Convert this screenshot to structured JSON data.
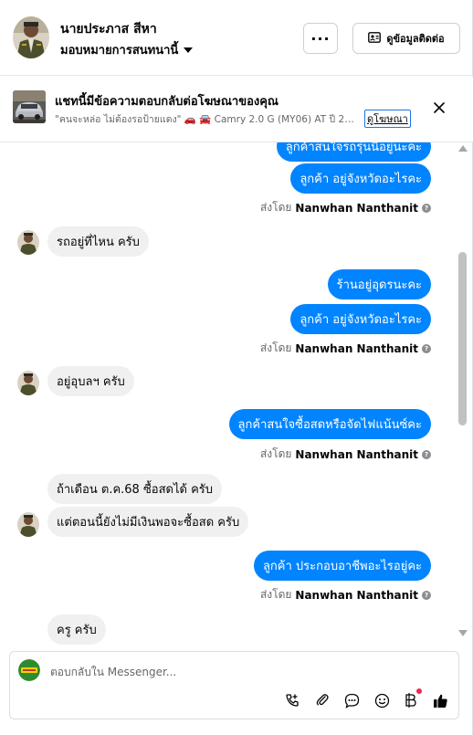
{
  "header": {
    "name": "นายประภาส สีหา",
    "subtitle": "มอบหมายการสนทนานี้",
    "more_label": "···",
    "contact_label": "ดูข้อมูลติดต่อ",
    "icons": [
      "profile-avatar",
      "caret-down-icon",
      "more-icon",
      "contact-card-icon"
    ]
  },
  "ad": {
    "title": "แชทนี้มีข้อความตอบกลับต่อโฆษณาของคุณ",
    "description": "\"คนจะหล่อ ไม่ต้องรอป้ายแดง\" 🚗 🚘 Camry 2.0 G (MY06) AT ปี 2007 ...",
    "link_label": "ดูโฆษณา",
    "icons": [
      "car-thumbnail",
      "close-icon"
    ]
  },
  "messages": [
    {
      "side": "out",
      "text": "ลูกค้าสนใจรถรุ่นนี้อยู่นะคะ"
    },
    {
      "side": "out",
      "text": "ลูกค้า อยู่จังหวัดอะไรคะ"
    },
    {
      "side": "out",
      "text": "รถอยู่ที่ไหน ครับ",
      "kind": "dummy"
    },
    {
      "side": "in",
      "text": "รถอยู่ที่ไหน ครับ"
    },
    {
      "side": "out",
      "text": "ร้านอยู่อุดรนะคะ"
    },
    {
      "side": "out",
      "text": "ลูกค้า อยู่จังหวัดอะไรคะ"
    },
    {
      "side": "in",
      "text": "อยู่อุบลฯ ครับ"
    },
    {
      "side": "out",
      "text": "ลูกค้าสนใจซื้อสดหรือจัดไฟแน้นซ์คะ"
    },
    {
      "side": "in",
      "text": "ถ้าเดือน ต.ค.68 ซื้อสดได้ ครับ"
    },
    {
      "side": "in",
      "text": "แต่ตอนนี้ยังไม่มีเงินพอจะซื้อสด ครับ"
    },
    {
      "side": "out",
      "text": "ลูกค้า ประกอบอาชีพอะไรอยู่คะ"
    },
    {
      "side": "in",
      "text": "ครู ครับ"
    }
  ],
  "sent_by": {
    "prefix": "ส่งโดย",
    "name": "Nanwhan Nanthanit"
  },
  "composer": {
    "placeholder": "ตอบกลับใน Messenger...",
    "icons": [
      "page-avatar",
      "call-add-icon",
      "attach-icon",
      "saved-reply-icon",
      "emoji-icon",
      "payment-icon",
      "like-icon"
    ]
  }
}
